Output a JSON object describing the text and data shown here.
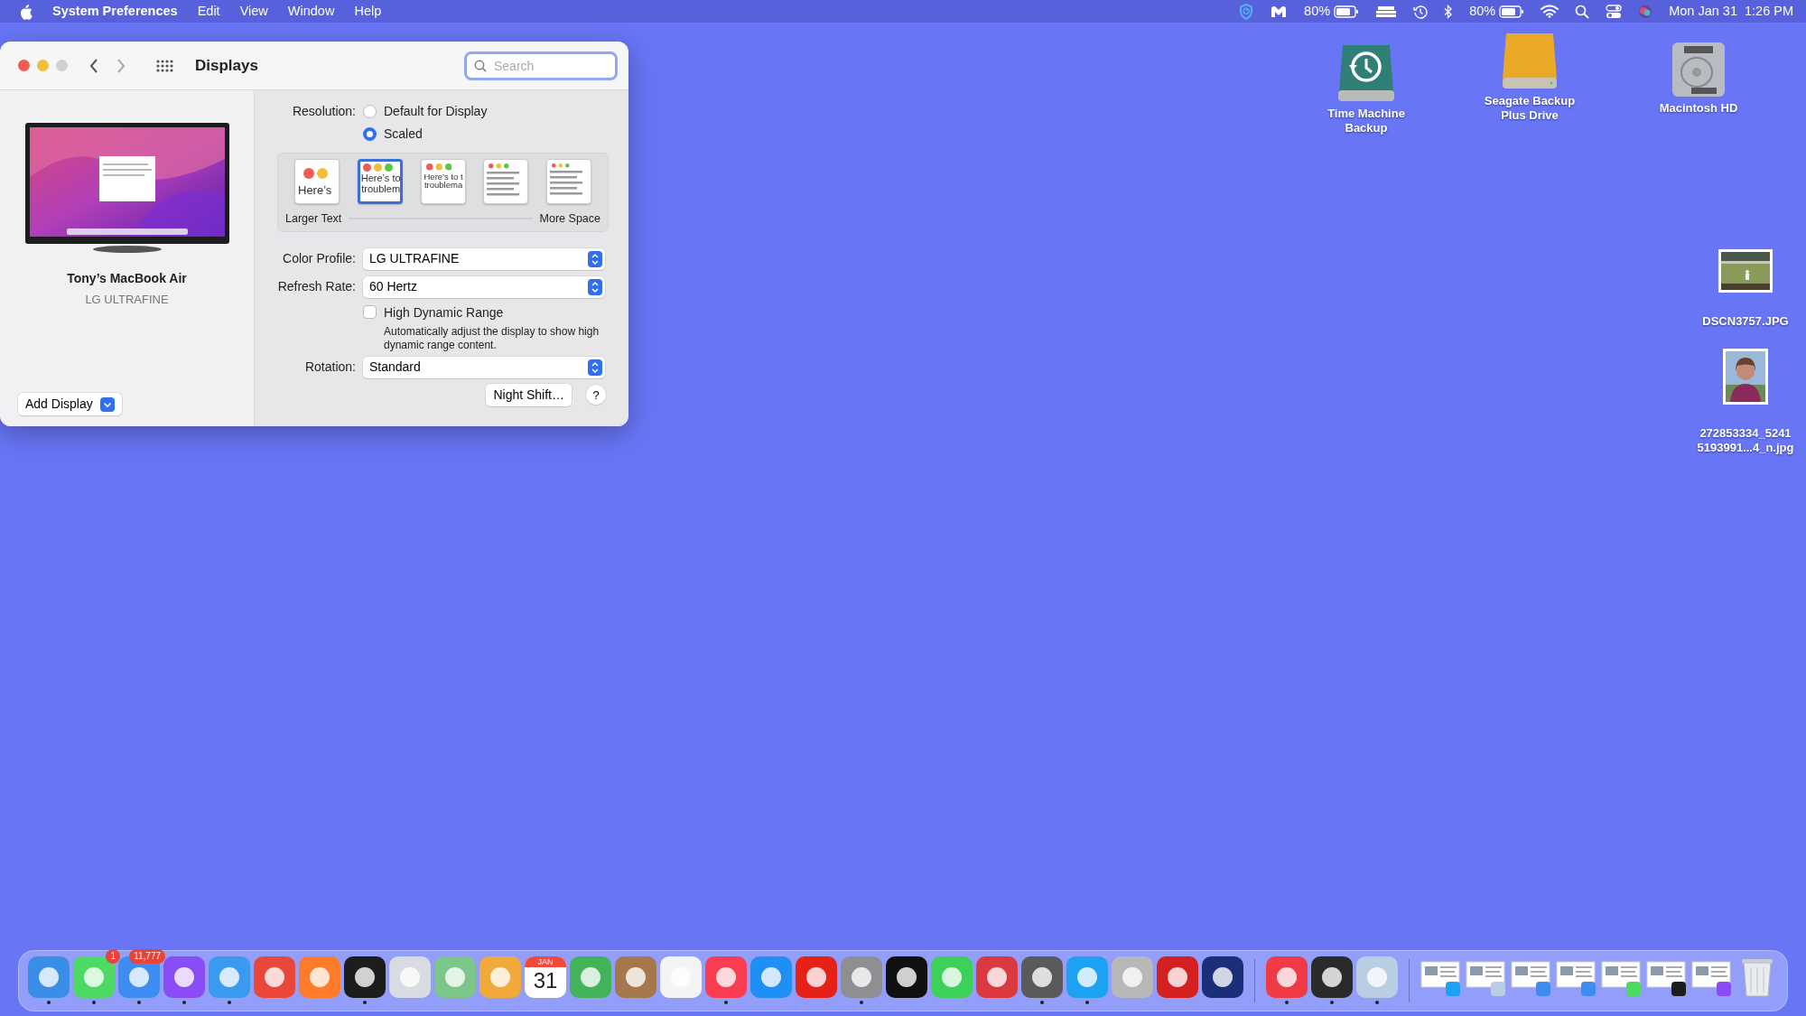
{
  "menu_bar": {
    "app_name": "System Preferences",
    "menus": [
      "Edit",
      "View",
      "Window",
      "Help"
    ],
    "battery_percent_1": "80%",
    "battery_percent_2": "80%",
    "clock": "Mon Jan 31  1:26 PM"
  },
  "window": {
    "title": "Displays",
    "search": {
      "placeholder": "Search"
    },
    "display": {
      "name": "Tony’s MacBook Air",
      "model": "LG ULTRAFINE"
    },
    "add_display": "Add Display",
    "resolution": {
      "label": "Resolution:",
      "options": [
        {
          "label": "Default for Display",
          "selected": false
        },
        {
          "label": "Scaled",
          "selected": true
        }
      ]
    },
    "scales": [
      {
        "sample": "Here’s",
        "selected": false
      },
      {
        "sample": "Here’s to\ntroublem",
        "selected": true
      },
      {
        "sample": "Here’s to t\ntroublema",
        "selected": false
      },
      {
        "selected": false
      },
      {
        "selected": false
      }
    ],
    "scale_left": "Larger Text",
    "scale_right": "More Space",
    "color_profile": {
      "label": "Color Profile:",
      "value": "LG ULTRAFINE"
    },
    "refresh_rate": {
      "label": "Refresh Rate:",
      "value": "60 Hertz"
    },
    "hdr": {
      "label": "High Dynamic Range",
      "checked": false,
      "description": "Automatically adjust the display to show high dynamic range content."
    },
    "rotation": {
      "label": "Rotation:",
      "value": "Standard"
    },
    "night_shift": "Night Shift…",
    "help": "?"
  },
  "desktop_icons": [
    {
      "kind": "backup-drive",
      "lines": [
        "Time Machine",
        "Backup"
      ]
    },
    {
      "kind": "external-drive",
      "lines": [
        "Seagate Backup",
        "Plus Drive"
      ]
    },
    {
      "kind": "internal-disk",
      "lines": [
        "Macintosh HD"
      ]
    },
    {
      "kind": "picture",
      "lines": [
        "DSCN3757.JPG"
      ]
    },
    {
      "kind": "picture",
      "lines": [
        "272853334_5241",
        "5193991...4_n.jpg"
      ]
    }
  ],
  "dock": [
    {
      "kind": "app",
      "color": "#3b8ee8",
      "running": true
    },
    {
      "kind": "app",
      "color": "#4cd964",
      "running": true,
      "badge": "1"
    },
    {
      "kind": "app",
      "color": "#3d8cf0",
      "running": true,
      "badge": "11,777"
    },
    {
      "kind": "app",
      "color": "#8a4cf5",
      "running": true
    },
    {
      "kind": "app",
      "color": "#3a9af0",
      "running": true
    },
    {
      "kind": "app",
      "color": "#e9473b",
      "running": false
    },
    {
      "kind": "app",
      "color": "#ff7b2a",
      "running": false
    },
    {
      "kind": "app",
      "color": "#1d1d1d",
      "running": true
    },
    {
      "kind": "app",
      "color": "#d9dbe2",
      "running": false
    },
    {
      "kind": "app",
      "color": "#7cc68a",
      "running": false
    },
    {
      "kind": "app",
      "color": "#f2a93b",
      "running": false
    },
    {
      "kind": "calendar",
      "month": "JAN",
      "day": "31",
      "running": false
    },
    {
      "kind": "app",
      "color": "#43b35a",
      "running": false
    },
    {
      "kind": "app",
      "color": "#a4774d",
      "running": false
    },
    {
      "kind": "app",
      "color": "#f4f4f6",
      "running": false
    },
    {
      "kind": "app",
      "color": "#fa3d51",
      "running": true
    },
    {
      "kind": "app",
      "color": "#1f8ff5",
      "running": false
    },
    {
      "kind": "app",
      "color": "#e62117",
      "running": false
    },
    {
      "kind": "app",
      "color": "#8e8e93",
      "running": true
    },
    {
      "kind": "app",
      "color": "#101010",
      "running": false
    },
    {
      "kind": "app",
      "color": "#3cd25a",
      "running": false
    },
    {
      "kind": "app",
      "color": "#da3940",
      "running": false
    },
    {
      "kind": "app",
      "color": "#5a5a5a",
      "running": true
    },
    {
      "kind": "app",
      "color": "#1da1f2",
      "running": true
    },
    {
      "kind": "app",
      "color": "#b8b8b8",
      "running": false
    },
    {
      "kind": "app",
      "color": "#d42020",
      "running": false
    },
    {
      "kind": "app",
      "color": "#1a2e7a",
      "running": false
    },
    {
      "kind": "separator"
    },
    {
      "kind": "app",
      "color": "#f03a45",
      "running": true
    },
    {
      "kind": "app",
      "color": "#2a2a2a",
      "running": true
    },
    {
      "kind": "app",
      "color": "#b9cde3",
      "running": true
    },
    {
      "kind": "separator"
    },
    {
      "kind": "window",
      "color": "#1da1f2"
    },
    {
      "kind": "window",
      "color": "#b9cde3"
    },
    {
      "kind": "window",
      "color": "#3d8cf0"
    },
    {
      "kind": "window",
      "color": "#3d8cf0"
    },
    {
      "kind": "window",
      "color": "#4cd964"
    },
    {
      "kind": "window",
      "color": "#1d1d1d"
    },
    {
      "kind": "window",
      "color": "#8a4cf5"
    },
    {
      "kind": "trash"
    }
  ]
}
